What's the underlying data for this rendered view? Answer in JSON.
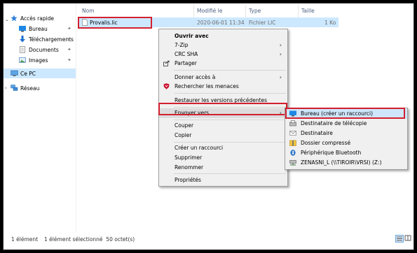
{
  "sidebar": {
    "quick_access": "Accès rapide",
    "items": [
      {
        "label": "Bureau",
        "icon": "desktop-icon"
      },
      {
        "label": "Téléchargements",
        "icon": "download-icon"
      },
      {
        "label": "Documents",
        "icon": "documents-icon"
      },
      {
        "label": "Images",
        "icon": "pictures-icon"
      }
    ],
    "this_pc": "Ce PC",
    "network": "Réseau"
  },
  "columns": {
    "name": "Nom",
    "modified": "Modifié le",
    "type": "Type",
    "size": "Taille"
  },
  "file": {
    "name": "Provalis.lic",
    "modified": "2020-06-01 11:34",
    "type": "Fichier LIC",
    "size": "1 Ko"
  },
  "context_menu": {
    "open_with": "Ouvrir avec",
    "zip": "7-Zip",
    "crc": "CRC SHA",
    "share": "Partager",
    "give_access": "Donner accès à",
    "scan": "Rechercher les menaces",
    "restore": "Restaurer les versions précédentes",
    "send_to": "Envoyer vers",
    "cut": "Couper",
    "copy": "Copier",
    "shortcut": "Créer un raccourci",
    "delete": "Supprimer",
    "rename": "Renommer",
    "properties": "Propriétés"
  },
  "send_to_menu": [
    {
      "label": "Bureau (créer un raccourci)",
      "icon": "desktop-icon"
    },
    {
      "label": "Destinataire de télécopie",
      "icon": "fax-icon"
    },
    {
      "label": "Destinataire",
      "icon": "mail-icon"
    },
    {
      "label": "Dossier compressé",
      "icon": "zip-folder-icon"
    },
    {
      "label": "Périphérique Bluetooth",
      "icon": "bluetooth-icon"
    },
    {
      "label": "ZENASNI_L (\\\\TIROIR\\VRSI) (Z:)",
      "icon": "network-drive-icon"
    }
  ],
  "status": {
    "count": "1 élément",
    "selected": "1 élément sélectionné  50 octet(s)"
  },
  "colors": {
    "selection": "#cce8ff",
    "highlight": "#d2202f",
    "menu_bg": "#f0f0f0"
  }
}
